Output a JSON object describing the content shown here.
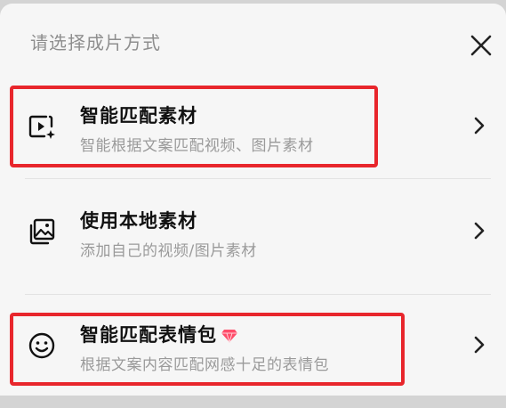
{
  "dialog": {
    "title": "请选择成片方式"
  },
  "options": [
    {
      "title": "智能匹配素材",
      "description": "智能根据文案匹配视频、图片素材",
      "icon": "video-sparkle-icon"
    },
    {
      "title": "使用本地素材",
      "description": "添加自己的视频/图片素材",
      "icon": "image-gallery-icon"
    },
    {
      "title": "智能匹配表情包",
      "description": "根据文案内容匹配网感十足的表情包",
      "icon": "smiley-icon",
      "badge_icon": "vip-diamond-icon"
    }
  ],
  "colors": {
    "highlight": "#e8262c",
    "badge": "#ff4d6a",
    "title": "#111111",
    "description": "#9a9a9a",
    "header": "#8e8e8e"
  }
}
